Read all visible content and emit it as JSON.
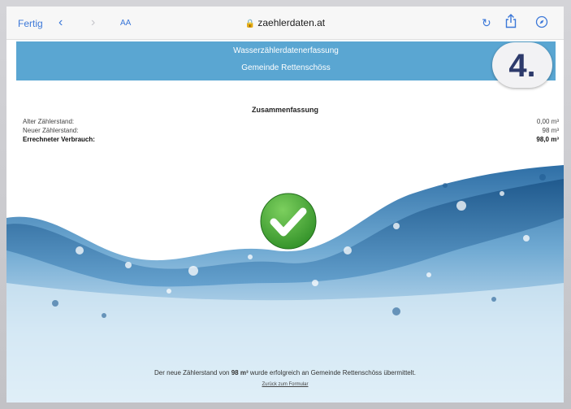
{
  "toolbar": {
    "done_label": "Fertig",
    "back_icon": "chevron-left-icon",
    "forward_icon": "chevron-right-icon",
    "text_size_label": "AA",
    "lock_icon": "lock-icon",
    "url": "zaehlerdaten.at",
    "reload_icon": "reload-icon",
    "share_icon": "share-icon",
    "compass_icon": "compass-icon"
  },
  "header": {
    "title": "Wasserzählerdatenerfassung",
    "subtitle": "Gemeinde Rettenschöss"
  },
  "step_badge": "4.",
  "summary": {
    "title": "Zusammenfassung",
    "rows": [
      {
        "label": "Alter Zählerstand:",
        "value": "0,00 m³"
      },
      {
        "label": "Neuer Zählerstand:",
        "value": "98 m³"
      },
      {
        "label": "Errechneter Verbrauch:",
        "value": "98,0 m³"
      }
    ]
  },
  "success_icon": "checkmark-icon",
  "footer": {
    "message_prefix": "Der neue Zählerstand von",
    "message_value": "98 m³",
    "message_suffix": "wurde erfolgreich an Gemeinde Rettenschöss übermittelt.",
    "back_link": "Zurück zum Formular"
  },
  "colors": {
    "header_bg": "#5aa6d2",
    "accent": "#3c78d8",
    "success": "#3a9b2e",
    "badge_text": "#2d3a6b"
  }
}
